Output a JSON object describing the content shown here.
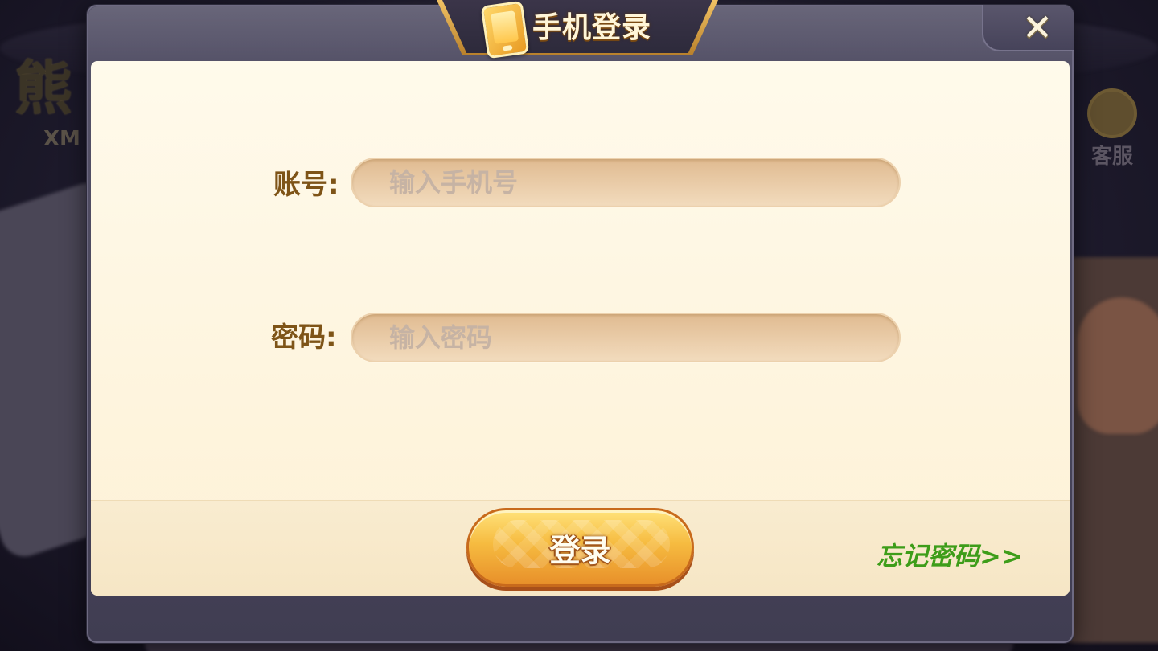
{
  "background": {
    "logo_text": "熊",
    "logo_subtext": "XM",
    "service_label": "客服"
  },
  "dialog": {
    "title": "手机登录",
    "title_icon": "phone-icon",
    "close_icon": "close-icon"
  },
  "form": {
    "account_label": "账号:",
    "account_value": "",
    "account_placeholder": "输入手机号",
    "password_label": "密码:",
    "password_value": "",
    "password_placeholder": "输入密码"
  },
  "actions": {
    "login_label": "登录",
    "forgot_label": "忘记密码>>"
  },
  "colors": {
    "label_brown": "#7e5417",
    "link_green": "#3d9d19",
    "button_orange": "#f6bb40",
    "panel_cream": "#fffaeb"
  }
}
